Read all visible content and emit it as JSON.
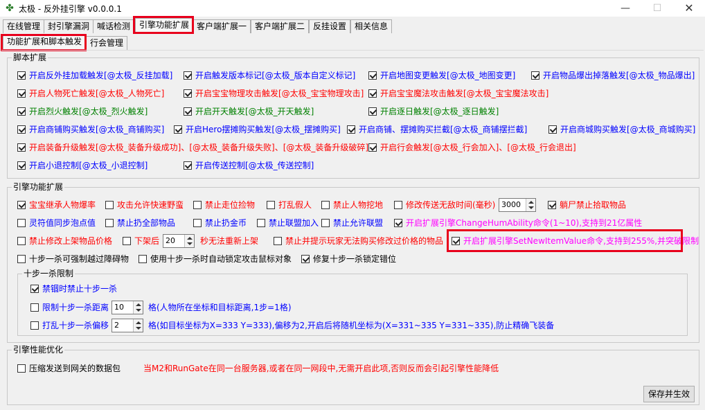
{
  "window": {
    "title": "太极 - 反外挂引擎 v0.0.0.1"
  },
  "main_tabs": [
    "在线管理",
    "封引擎漏洞",
    "喊话检测",
    "引擎功能扩展",
    "客户端扩展一",
    "客户端扩展二",
    "反挂设置",
    "相关信息"
  ],
  "sub_tabs": [
    "功能扩展和脚本触发",
    "行会管理"
  ],
  "script_group": {
    "title": "脚本扩展",
    "items": [
      "开启反外挂加载触发[@太极_反挂加载]",
      "开启触发版本标记[@太极_版本自定义标记]",
      "开启地图变更触发[@太极_地图变更]",
      "开启物品爆出掉落触发[@太极_物品爆出]",
      "开启人物死亡触发[@太极_人物死亡]",
      "开启宝宝物理攻击触发[@太极_宝宝物理攻击]",
      "开启宝宝魔法攻击触发[@太极_宝宝魔法攻击]",
      "开启烈火触发[@太极_烈火触发]",
      "开启开天触发[@太极_开天触发]",
      "开启逐日触发[@太极_逐日触发]",
      "开启商铺购买触发[@太极_商铺购买]",
      "开启Hero摆摊购买触发[@太极_摆摊购买]",
      "开启商铺、摆摊购买拦截[@太极_商铺摆拦截]",
      "开启商城购买触发[@太极_商城购买]",
      "开启装备升级触发[@太极_装备升级成功]、[@太极_装备升级失败]、[@太极_装备升级破碎]",
      "开启行会触发[@太极_行会加入]、[@太极_行会退出]",
      "开启小退控制[@太极_小退控制]",
      "开启传送控制[@太极_传送控制]"
    ]
  },
  "engine_group": {
    "title": "引擎功能扩展",
    "row1": [
      "宝宝继承人物爆率",
      "攻击允许快速野蛮",
      "禁止走位捡物",
      "打乱假人",
      "禁止人物挖地",
      "修改传送无敌时间(毫秒)",
      "躺尸禁止拾取物品"
    ],
    "invincible_ms": "3000",
    "row2": [
      "灵符值同步泡点值",
      "禁止扔全部物品",
      "禁止扔金币",
      "禁止联盟加入",
      "禁止允许联盟",
      "开启扩展引擎ChangeHumAbility命令(1~10),支持到21亿属性"
    ],
    "row3": [
      "禁止修改上架物品价格",
      "下架后",
      "禁止并提示玩家无法购买修改过价格的物品",
      "开启扩展引擎SetNewItemValue命令,支持到255%,并突破限制"
    ],
    "delist_value": "20",
    "delist_suffix": "秒无法重新上架",
    "row4": [
      "十步一杀可强制越过障碍物",
      "使用十步一杀时自动锁定攻击鼠标对象",
      "修复十步一杀锁定错位"
    ]
  },
  "tenstep_group": {
    "title": "十步一杀限制",
    "jail": "禁锢时禁止十步一杀",
    "limit_label": "限制十步一杀距离",
    "limit_value": "10",
    "limit_suffix": "格(人物所在坐标和目标距离,1步=1格)",
    "offset_label": "打乱十步一杀偏移",
    "offset_value": "2",
    "offset_suffix": "格(如目标坐标为X=333 Y=333),偏移为2,开启后将随机坐标为(X=331~335 Y=331~335),防止精确飞装备"
  },
  "perf_group": {
    "title": "引擎性能优化",
    "compress": "压缩发送到网关的数据包",
    "note": "当M2和RunGate在同一台服务器,或者在同一网段中,无需开启此项,否则反而会引起引擎性能降低"
  },
  "save_button": "保存并生效",
  "colors": {
    "highlight": "#e8001c",
    "blue": "#0000ff",
    "red": "#ff0000",
    "green": "#008000",
    "magenta": "#ff00ff"
  }
}
